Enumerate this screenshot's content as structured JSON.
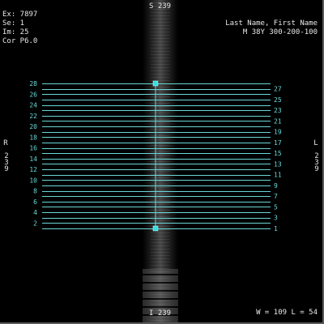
{
  "header": {
    "top_orientation": "S 239",
    "bottom_orientation": "I 239",
    "left_letter": "R",
    "left_number": "239",
    "right_letter": "L",
    "right_number": "239"
  },
  "study_info": {
    "exam": "Ex: 7897",
    "series": "Se: 1",
    "image": "Im: 25",
    "plane": "Cor P6.0"
  },
  "patient": {
    "name": "Last Name, First Name",
    "details": "M 38Y 300-200-100"
  },
  "window_level": {
    "w_label": "W =",
    "w_value": "109",
    "l_label": "L =",
    "l_value": "54"
  },
  "slices": {
    "left_labels": [
      "28",
      "26",
      "24",
      "22",
      "20",
      "18",
      "16",
      "14",
      "12",
      "10",
      "8",
      "6",
      "4",
      "2"
    ],
    "right_labels": [
      "27",
      "25",
      "23",
      "21",
      "19",
      "17",
      "15",
      "13",
      "11",
      "9",
      "7",
      "5",
      "3",
      "1"
    ],
    "total": 28
  },
  "colors": {
    "overlay": "#6ad6d6",
    "handle": "#33e0e0",
    "text": "#e8e8e8"
  }
}
